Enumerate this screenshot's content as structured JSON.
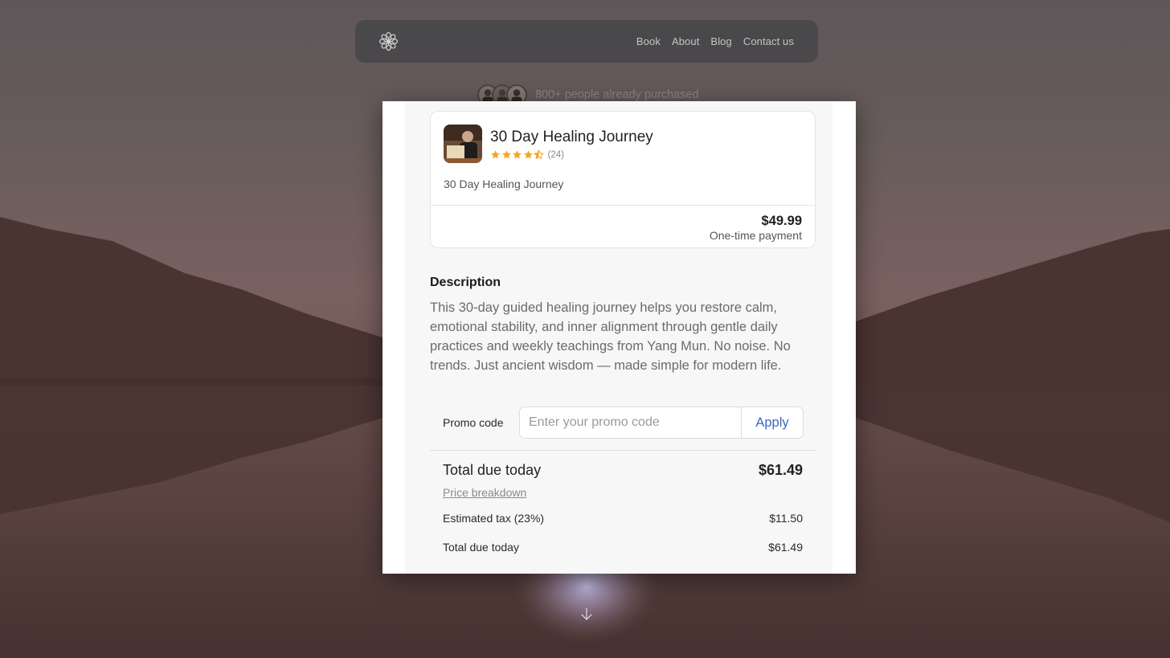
{
  "nav": {
    "logo_icon": "flower-logo-icon",
    "links": [
      "Book",
      "About",
      "Blog",
      "Contact us"
    ]
  },
  "social_proof": {
    "text": "800+ people already purchased"
  },
  "product": {
    "title": "30 Day Healing Journey",
    "rating": 4.5,
    "rating_count": "(24)",
    "subtitle": "30 Day Healing Journey",
    "price": "$49.99",
    "payment_note": "One-time payment"
  },
  "description": {
    "heading": "Description",
    "body": "This 30-day guided healing journey helps you restore calm, emotional stability, and inner alignment through gentle daily practices and weekly teachings from Yang Mun. No noise. No trends. Just ancient wisdom — made simple for modern life."
  },
  "promo": {
    "label": "Promo code",
    "placeholder": "Enter your promo code",
    "value": "",
    "apply_label": "Apply"
  },
  "totals": {
    "total_label": "Total due today",
    "total_value": "$61.49",
    "breakdown_link": "Price breakdown",
    "tax_label": "Estimated tax (23%)",
    "tax_value": "$11.50",
    "line_total_label": "Total due today",
    "line_total_value": "$61.49"
  },
  "colors": {
    "accent": "#3a66c4",
    "star": "#f5a623"
  }
}
